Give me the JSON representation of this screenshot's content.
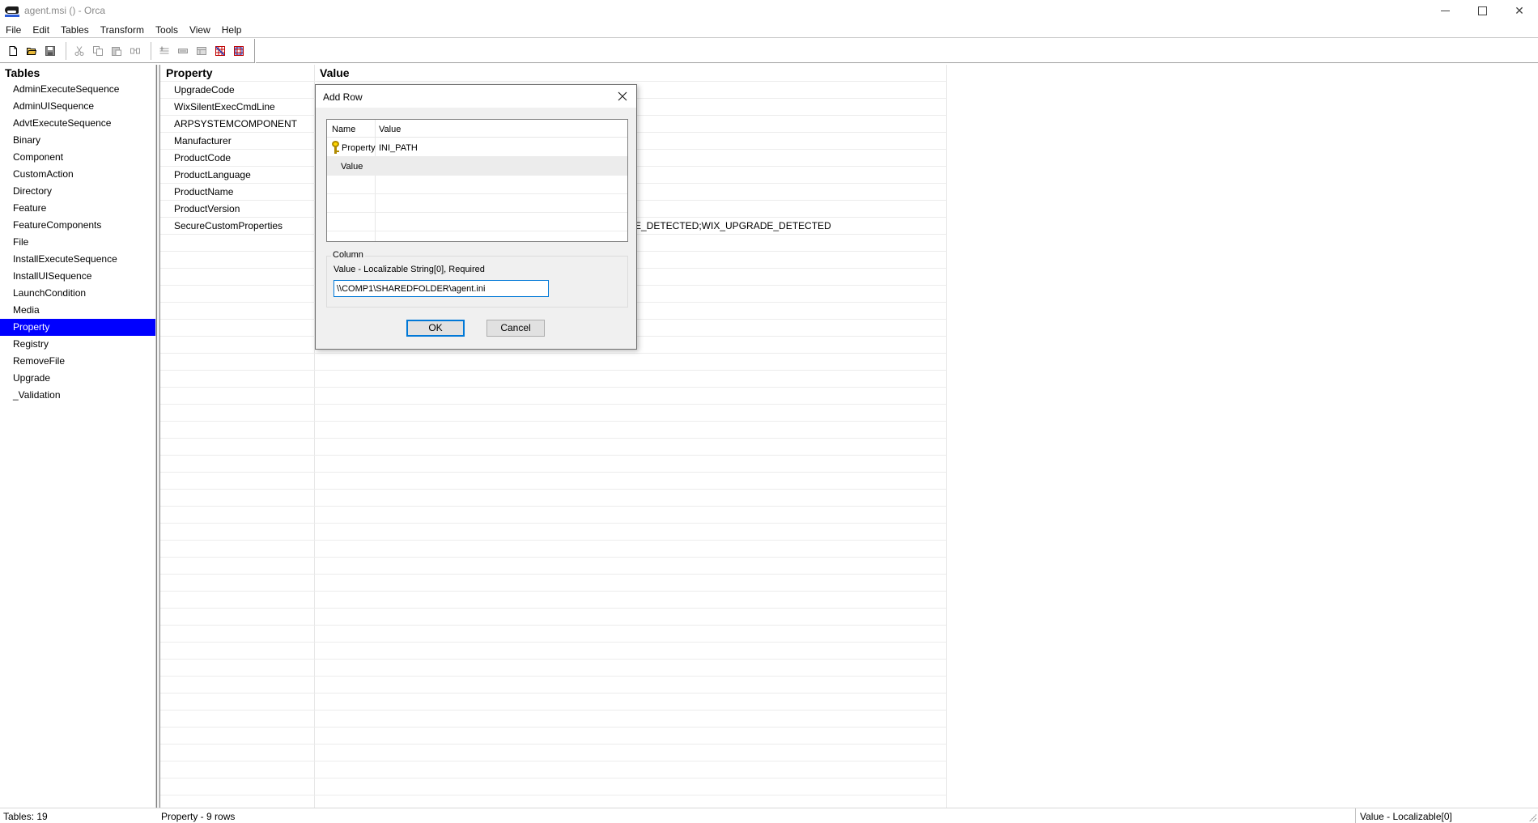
{
  "window": {
    "title": "agent.msi () - Orca",
    "minimize": "minimize",
    "maximize": "maximize",
    "close": "✕"
  },
  "menu": [
    "File",
    "Edit",
    "Tables",
    "Transform",
    "Tools",
    "View",
    "Help"
  ],
  "toolbar": {
    "icons": [
      "new-file-icon",
      "open-folder-icon",
      "save-icon",
      "cut-icon",
      "copy-icon",
      "paste-icon",
      "find-icon",
      "add-row-icon",
      "drop-row-icon",
      "add-table-icon",
      "drop-table-icon",
      "validate-icon",
      "import-icon"
    ]
  },
  "tables_pane": {
    "header": "Tables",
    "items": [
      "AdminExecuteSequence",
      "AdminUISequence",
      "AdvtExecuteSequence",
      "Binary",
      "Component",
      "CustomAction",
      "Directory",
      "Feature",
      "FeatureComponents",
      "File",
      "InstallExecuteSequence",
      "InstallUISequence",
      "LaunchCondition",
      "Media",
      "Property",
      "Registry",
      "RemoveFile",
      "Upgrade",
      "_Validation"
    ],
    "selected": "Property"
  },
  "grid": {
    "columns": [
      "Property",
      "Value"
    ],
    "rows": [
      {
        "property": "UpgradeCode",
        "value": ""
      },
      {
        "property": "WixSilentExecCmdLine",
        "value": ""
      },
      {
        "property": "ARPSYSTEMCOMPONENT",
        "value": ""
      },
      {
        "property": "Manufacturer",
        "value": ""
      },
      {
        "property": "ProductCode",
        "value": ""
      },
      {
        "property": "ProductLanguage",
        "value": ""
      },
      {
        "property": "ProductName",
        "value": ""
      },
      {
        "property": "ProductVersion",
        "value": ""
      },
      {
        "property": "SecureCustomProperties",
        "value": "E_DETECTED;WIX_UPGRADE_DETECTED"
      }
    ]
  },
  "dialog": {
    "title": "Add Row",
    "list_headers": {
      "name": "Name",
      "value": "Value"
    },
    "fields": [
      {
        "name": "Property",
        "value": "INI_PATH"
      },
      {
        "name": "Value",
        "value": ""
      }
    ],
    "column_group": {
      "legend": "Column",
      "description": "Value - Localizable String[0], Required",
      "input_value": "\\\\COMP1\\SHAREDFOLDER\\agent.ini"
    },
    "ok_label": "OK",
    "cancel_label": "Cancel"
  },
  "status": {
    "tables": "Tables: 19",
    "rows": "Property - 9 rows",
    "column": "Value - Localizable[0]"
  },
  "colors": {
    "selection": "#0000ff",
    "focus": "#0078d7"
  }
}
